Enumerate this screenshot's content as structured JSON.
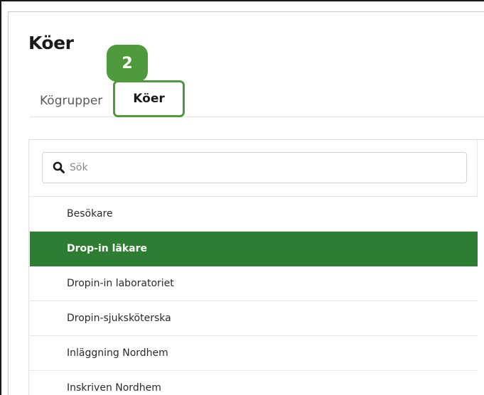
{
  "page": {
    "title": "Köer"
  },
  "step_badge": {
    "number": "2"
  },
  "tabs": [
    {
      "label": "Kögrupper",
      "active": false
    },
    {
      "label": "Köer",
      "active": true
    }
  ],
  "search": {
    "placeholder": "Sök",
    "value": ""
  },
  "queues": [
    {
      "label": "Besökare",
      "selected": false
    },
    {
      "label": "Drop-in läkare",
      "selected": true
    },
    {
      "label": "Dropin-in laboratoriet",
      "selected": false
    },
    {
      "label": "Dropin-sjuksköterska",
      "selected": false
    },
    {
      "label": "Inläggning Nordhem",
      "selected": false
    },
    {
      "label": "Inskriven Nordhem",
      "selected": false
    }
  ],
  "colors": {
    "accent": "#4f9a3c",
    "selected_row": "#2f7d32"
  }
}
